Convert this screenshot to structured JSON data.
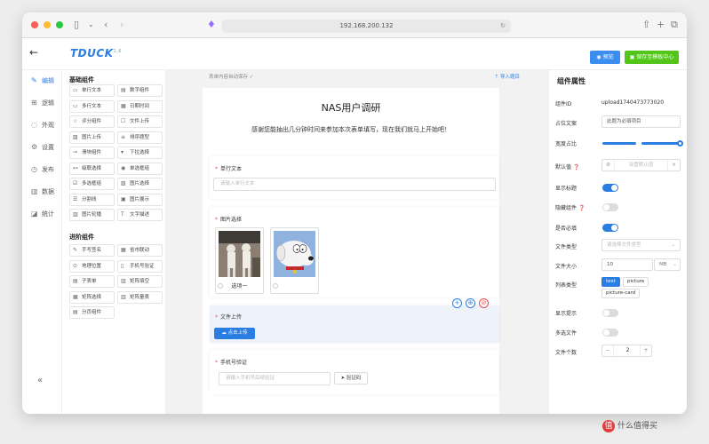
{
  "browser": {
    "url": "192.168.200.132"
  },
  "header": {
    "logo": "TDUCK",
    "logo_version": "1.6",
    "preview_label": "预览",
    "save_label": "保存至模板中心"
  },
  "leftnav": {
    "items": [
      {
        "icon": "edit-icon",
        "label": "编辑",
        "active": true
      },
      {
        "icon": "logic-icon",
        "label": "逻辑"
      },
      {
        "icon": "appearance-icon",
        "label": "外观"
      },
      {
        "icon": "settings-icon",
        "label": "设置"
      },
      {
        "icon": "publish-icon",
        "label": "发布"
      },
      {
        "icon": "data-icon",
        "label": "数据"
      },
      {
        "icon": "stats-icon",
        "label": "统计"
      }
    ]
  },
  "components": {
    "basic_title": "基础组件",
    "basic": [
      "单行文本",
      "数字组件",
      "多行文本",
      "日期时间",
      "评分组件",
      "文件上传",
      "图片上传",
      "排序题型",
      "滑块组件",
      "下拉选择",
      "级联选择",
      "单选框组",
      "多选框组",
      "图片选择",
      "分割线",
      "图片展示",
      "图片轮播",
      "文字描述"
    ],
    "advanced_title": "进阶组件",
    "advanced": [
      "手写签名",
      "省市联动",
      "地理位置",
      "手机号验证",
      "子表单",
      "矩阵填空",
      "矩阵选择",
      "矩阵量表",
      "分页组件"
    ]
  },
  "canvas": {
    "autosave": "表单内容自动保存 ✓",
    "import": "导入题目"
  },
  "form": {
    "title": "NAS用户调研",
    "description": "感谢您能抽出几分钟时间来参加本次表单填写，现在我们就马上开始吧！",
    "q1_label": "单行文本",
    "q1_placeholder": "请输入单行文本",
    "q2_label": "图片选择",
    "q2_opt1": "选项一",
    "q3_label": "文件上传",
    "q3_button": "点击上传",
    "q4_label": "手机号验证",
    "q4_placeholder": "请输入手机号后续验证",
    "q4_button": "验证码"
  },
  "props": {
    "title": "组件属性",
    "id_label": "组件ID",
    "id_value": "upload1740473773020",
    "placeholder_label": "占位文案",
    "placeholder_value": "此题为必填项目",
    "width_label": "宽度占比",
    "width_value": 1.0,
    "default_label": "默认值",
    "default_placeholder": "设置默认值",
    "show_title_label": "显示标题",
    "show_title": true,
    "hidden_label": "隐藏组件",
    "hidden": false,
    "required_label": "是否必填",
    "required": true,
    "file_type_label": "文件类型",
    "file_type_placeholder": "请选择文件类型",
    "file_size_label": "文件大小",
    "file_size_value": "10",
    "file_size_unit": "MB",
    "list_type_label": "列表类型",
    "list_types": [
      "text",
      "picture",
      "picture-card"
    ],
    "show_tip_label": "显示提示",
    "show_tip": false,
    "multiple_label": "多选文件",
    "multiple": false,
    "count_label": "文件个数",
    "count_value": "2"
  },
  "watermark": {
    "text": "什么值得买"
  }
}
